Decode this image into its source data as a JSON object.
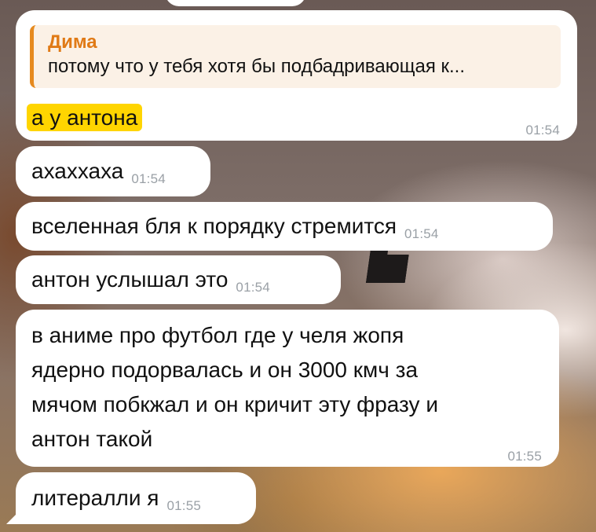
{
  "reply": {
    "author": "Дима",
    "quoted_text": "потому что у тебя хотя бы подбадривающая к..."
  },
  "messages": [
    {
      "text": "а у антона",
      "time": "01:54",
      "highlighted": true
    },
    {
      "text": "ахаххаха",
      "time": "01:54"
    },
    {
      "text": "вселенная бля к порядку стремится",
      "time": "01:54"
    },
    {
      "text": "антон услышал это",
      "time": "01:54"
    },
    {
      "lines": [
        "в аниме про футбол где у челя жопя",
        "ядерно подорвалась и он 3000 кмч за",
        "мячом побкжал и он кричит эту фразу и",
        "антон такой"
      ],
      "time": "01:55"
    },
    {
      "text": "литералли я",
      "time": "01:55"
    }
  ],
  "colors": {
    "reply_accent": "#e68a1f",
    "highlight": "#ffd500",
    "bubble": "#ffffff",
    "time": "#9aa0a6"
  }
}
